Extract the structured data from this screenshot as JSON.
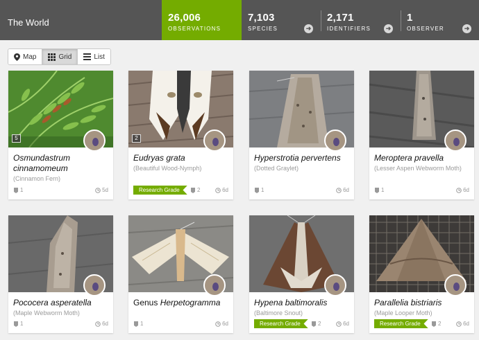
{
  "header": {
    "place": "The World",
    "stats": [
      {
        "value": "26,006",
        "label": "OBSERVATIONS"
      },
      {
        "value": "7,103",
        "label": "SPECIES"
      },
      {
        "value": "2,171",
        "label": "IDENTIFIERS"
      },
      {
        "value": "1",
        "label": "OBSERVER"
      }
    ],
    "accent_color": "#74ac00"
  },
  "views": [
    {
      "label": "Map",
      "icon": "map-marker-icon"
    },
    {
      "label": "Grid",
      "icon": "grid-icon",
      "active": true
    },
    {
      "label": "List",
      "icon": "list-icon"
    }
  ],
  "observations": [
    {
      "name_line1": "Osmundastrum",
      "name_line2": "cinnamomeum",
      "common": "(Cinnamon Fern)",
      "photos": "5",
      "ids": "1",
      "age": "5d",
      "research_grade": false
    },
    {
      "name_line1": "Eudryas grata",
      "common": "(Beautiful Wood-Nymph)",
      "photos": "2",
      "ids": "2",
      "age": "6d",
      "research_grade": true
    },
    {
      "name_line1": "Hyperstrotia pervertens",
      "common": "(Dotted Graylet)",
      "ids": "1",
      "age": "6d",
      "research_grade": false
    },
    {
      "name_line1": "Meroptera pravella",
      "common": "(Lesser Aspen Webworm Moth)",
      "ids": "1",
      "age": "6d",
      "research_grade": false
    },
    {
      "name_line1": "Pococera asperatella",
      "common": "(Maple Webworm Moth)",
      "ids": "1",
      "age": "6d",
      "research_grade": false
    },
    {
      "name_prefix": "Genus ",
      "name_line1": "Herpetogramma",
      "ids": "1",
      "age": "6d",
      "research_grade": false
    },
    {
      "name_line1": "Hypena baltimoralis",
      "common": "(Baltimore Snout)",
      "ids": "2",
      "age": "6d",
      "research_grade": true
    },
    {
      "name_line1": "Parallelia bistriaris",
      "common": "(Maple Looper Moth)",
      "ids": "2",
      "age": "6d",
      "research_grade": true
    }
  ],
  "research_grade_label": "Research Grade"
}
